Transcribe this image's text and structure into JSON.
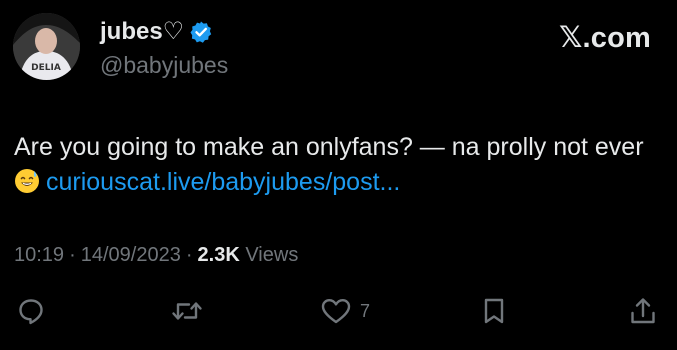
{
  "author": {
    "display_name": "jubes♡",
    "handle": "@babyjubes",
    "verified_icon": "verified-badge-icon",
    "avatar_shirt_text": "DELIA"
  },
  "brand": {
    "label": "𝕏.com"
  },
  "tweet": {
    "text": "Are you going to make an onlyfans? — na prolly not ever",
    "emoji": "sweat-smile-emoji",
    "link": "curiouscat.live/babyjubes/post..."
  },
  "meta": {
    "time": "10:19",
    "date": "14/09/2023",
    "views_count": "2.3K",
    "views_label": "Views"
  },
  "actions": {
    "reply_icon": "reply-icon",
    "retweet_icon": "retweet-icon",
    "like_icon": "heart-icon",
    "like_count": "7",
    "bookmark_icon": "bookmark-icon",
    "share_icon": "share-icon"
  },
  "colors": {
    "background": "#000000",
    "text": "#e7e9ea",
    "muted": "#71767b",
    "link": "#1d9bf0",
    "verified": "#1d9bf0"
  }
}
